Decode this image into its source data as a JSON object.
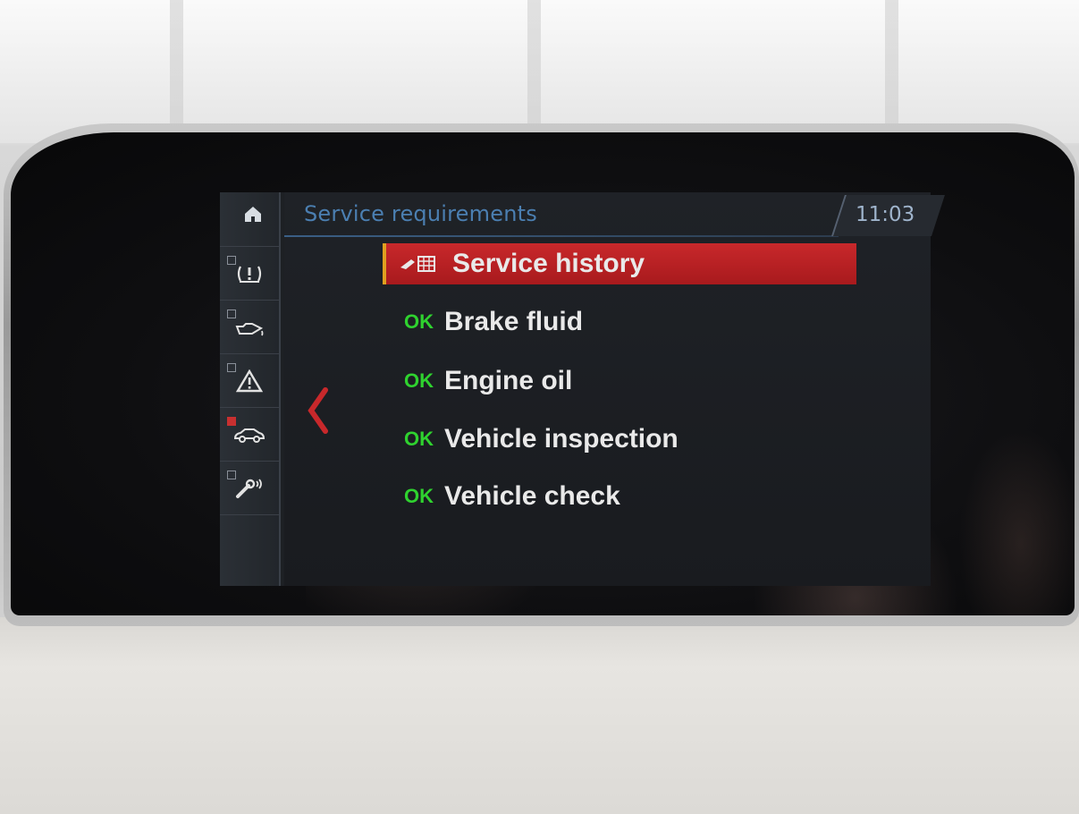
{
  "header": {
    "title": "Service requirements",
    "clock": "11:03"
  },
  "sidebar": {
    "items": [
      {
        "name": "home-icon"
      },
      {
        "name": "tire-pressure-icon",
        "glyph": "(!)"
      },
      {
        "name": "oil-can-icon",
        "glyph": "⛽"
      },
      {
        "name": "warning-triangle-icon",
        "glyph": "⚠"
      },
      {
        "name": "vehicle-icon",
        "glyph": "🚗"
      },
      {
        "name": "service-wrench-icon",
        "glyph": "🔧"
      }
    ]
  },
  "menu": {
    "selected": {
      "label": "Service history",
      "icon": "service-history-icon"
    },
    "items": [
      {
        "status": "OK",
        "label": "Brake fluid"
      },
      {
        "status": "OK",
        "label": "Engine oil"
      },
      {
        "status": "OK",
        "label": "Vehicle inspection"
      },
      {
        "status": "OK",
        "label": "Vehicle check"
      }
    ]
  },
  "colors": {
    "accent_red": "#c8282b",
    "ok_green": "#2fd22f",
    "title_blue": "#4b7fb1"
  }
}
